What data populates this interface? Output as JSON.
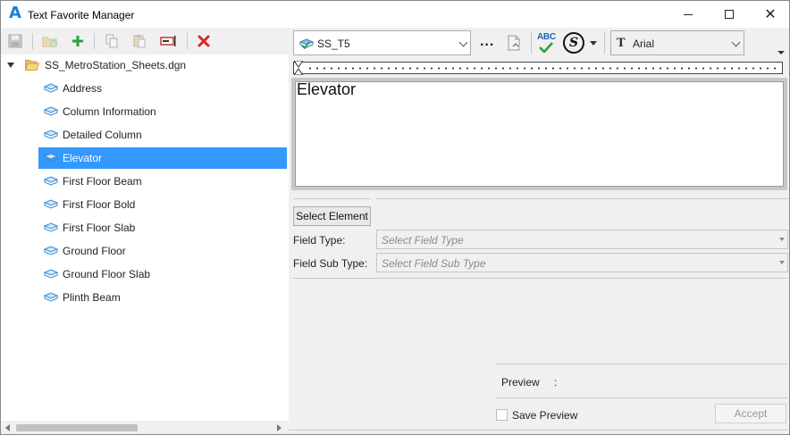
{
  "window": {
    "title": "Text Favorite Manager",
    "app_icon": "A"
  },
  "left_toolbar": {
    "buttons": [
      "save-icon",
      "add-folder-icon",
      "add-icon",
      "copy-icon",
      "paste-icon",
      "rename-icon",
      "delete-icon"
    ]
  },
  "tree": {
    "root": {
      "label": "SS_MetroStation_Sheets.dgn",
      "expanded": true
    },
    "items": [
      {
        "label": "Address"
      },
      {
        "label": "Column Information"
      },
      {
        "label": "Detailed Column"
      },
      {
        "label": "Elevator",
        "selected": true
      },
      {
        "label": "First Floor Beam"
      },
      {
        "label": "First Floor Bold"
      },
      {
        "label": "First Floor Slab"
      },
      {
        "label": "Ground Floor"
      },
      {
        "label": "Ground Floor Slab"
      },
      {
        "label": "Plinth Beam"
      }
    ]
  },
  "editor_toolbar": {
    "text_style": "SS_T5",
    "more_label": "...",
    "spell_label": "ABC",
    "symbol_label": "S",
    "font": "Arial",
    "font_icon_glyph": "T"
  },
  "editor": {
    "text": "Elevator"
  },
  "fields": {
    "select_element_label": "Select Element",
    "field_type_label": "Field Type:",
    "field_type_placeholder": "Select Field Type",
    "field_sub_type_label": "Field Sub Type:",
    "field_sub_type_placeholder": "Select Field Sub Type"
  },
  "preview": {
    "label": "Preview",
    "colon": ":",
    "save_preview_label": "Save Preview",
    "save_preview_checked": false,
    "accept_label": "Accept",
    "accept_enabled": false
  },
  "colors": {
    "selection": "#3399ff",
    "accent_blue": "#1a7fd6",
    "delete_red": "#d9252b",
    "add_green": "#2ea043"
  }
}
